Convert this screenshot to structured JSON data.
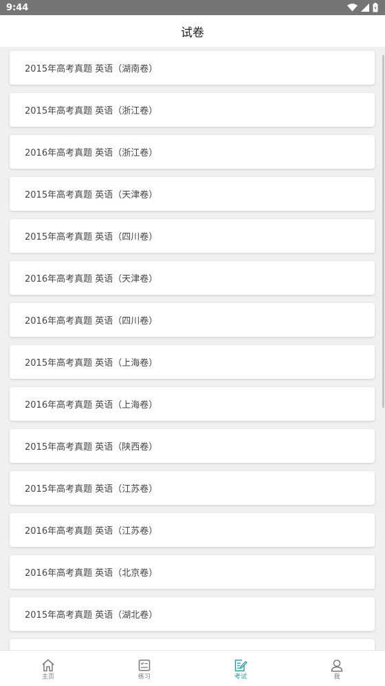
{
  "status_bar": {
    "time": "9:44"
  },
  "header": {
    "title": "试卷"
  },
  "papers": [
    "2015年高考真题 英语（湖南卷）",
    "2015年高考真题 英语（浙江卷）",
    "2016年高考真题 英语（浙江卷）",
    "2015年高考真题 英语（天津卷）",
    "2015年高考真题 英语（四川卷）",
    "2016年高考真题 英语（天津卷）",
    "2016年高考真题 英语（四川卷）",
    "2015年高考真题 英语（上海卷）",
    "2016年高考真题 英语（上海卷）",
    "2015年高考真题 英语（陕西卷）",
    "2015年高考真题 英语（江苏卷）",
    "2016年高考真题 英语（江苏卷）",
    "2016年高考真题 英语（北京卷）",
    "2015年高考真题 英语（湖北卷）",
    ""
  ],
  "bottom_nav": {
    "home": "主页",
    "practice": "练习",
    "exam": "考试",
    "me": "我"
  },
  "colors": {
    "accent": "#2a9d9a",
    "inactive": "#777777"
  }
}
